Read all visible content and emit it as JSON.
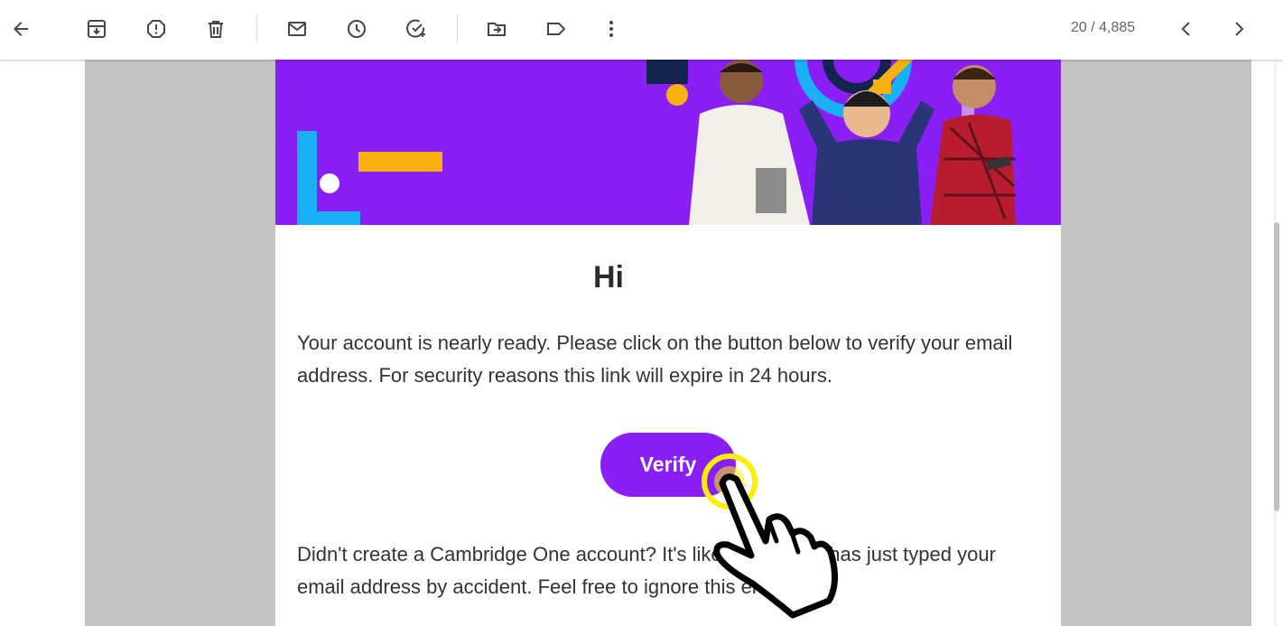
{
  "toolbar": {
    "back_icon": "arrow-left-icon",
    "archive_icon": "archive-icon",
    "report_spam_icon": "report-spam-icon",
    "delete_icon": "trash-icon",
    "mark_unread_icon": "mail-icon",
    "snooze_icon": "clock-icon",
    "add_task_icon": "add-task-icon",
    "move_to_icon": "move-to-folder-icon",
    "label_icon": "label-icon",
    "more_icon": "more-vert-icon",
    "counter": "20 / 4,885",
    "prev_icon": "chevron-left-icon",
    "next_icon": "chevron-right-icon"
  },
  "email": {
    "greeting": "Hi",
    "paragraph1": "Your account is nearly ready. Please click on the button below to verify your email address. For security reasons this link will expire in 24 hours.",
    "verify_label": "Verify",
    "paragraph2": "Didn't create a Cambridge One account? It's likely someone has just typed your email address by accident. Feel free to ignore this email.",
    "accent_color": "#8a1ff5"
  },
  "overlay": {
    "cursor_icon": "hand-pointer-icon",
    "highlight_color": "#ffee00"
  }
}
